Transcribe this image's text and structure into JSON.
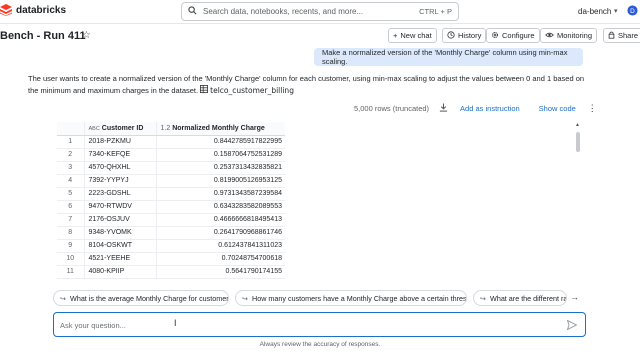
{
  "app": {
    "brand": "databricks"
  },
  "search": {
    "placeholder": "Search data, notebooks, recents, and more...",
    "shortcut": "CTRL + P"
  },
  "header": {
    "workspace": "da-bench"
  },
  "page": {
    "title": "Bench - Run 411"
  },
  "toolbar": {
    "new_chat": "New chat",
    "history": "History",
    "configure": "Configure",
    "monitoring": "Monitoring",
    "share": "Share"
  },
  "chat": {
    "user_message": "Make a normalized version of the 'Monthly Charge' column using min-max scaling.",
    "assistant_text": "The user wants to create a normalized version of the 'Monthly Charge' column for each customer, using min-max scaling to adjust the values between 0 and 1 based on the minimum and maximum charges in the dataset.",
    "table_tag": "telco_customer_billing"
  },
  "results": {
    "rows_label": "5,000 rows (truncated)",
    "add_instruction": "Add as instruction",
    "show_code": "Show code",
    "columns": {
      "customer_id": "Customer ID",
      "normalized": "Normalized Monthly Charge",
      "abc_type": "ABC",
      "num_type": "1.2"
    },
    "rows": [
      {
        "idx": "1",
        "id": "2018-PZKMU",
        "val": "0.8442785917822995"
      },
      {
        "idx": "2",
        "id": "7340-KEFQE",
        "val": "0.1587064752531289"
      },
      {
        "idx": "3",
        "id": "4570-QHXHL",
        "val": "0.2537313432835821"
      },
      {
        "idx": "4",
        "id": "7392-YYPYJ",
        "val": "0.8199005126953125"
      },
      {
        "idx": "5",
        "id": "2223-GDSHL",
        "val": "0.9731343587239584"
      },
      {
        "idx": "6",
        "id": "9470-RTWDV",
        "val": "0.6343283582089553"
      },
      {
        "idx": "7",
        "id": "2176-OSJUV",
        "val": "0.4666666818495413"
      },
      {
        "idx": "8",
        "id": "9348-YVOMK",
        "val": "0.2641790968861746"
      },
      {
        "idx": "9",
        "id": "8104-OSKWT",
        "val": "0.612437841311023"
      },
      {
        "idx": "10",
        "id": "4521-YEEHE",
        "val": "0.70248754700618"
      },
      {
        "idx": "11",
        "id": "4080-KPIIP",
        "val": "0.5641790174155"
      }
    ]
  },
  "suggestions": [
    "What is the average Monthly Charge for customers?",
    "How many customers have a Monthly Charge above a certain threshold?",
    "What are the different range"
  ],
  "input": {
    "placeholder": "Ask your question..."
  },
  "footer": {
    "note": "Always review the accuracy of responses."
  },
  "colors": {
    "accent": "#1a6fc9",
    "bubble": "#dce8fb",
    "brand_red": "#ff3621"
  }
}
